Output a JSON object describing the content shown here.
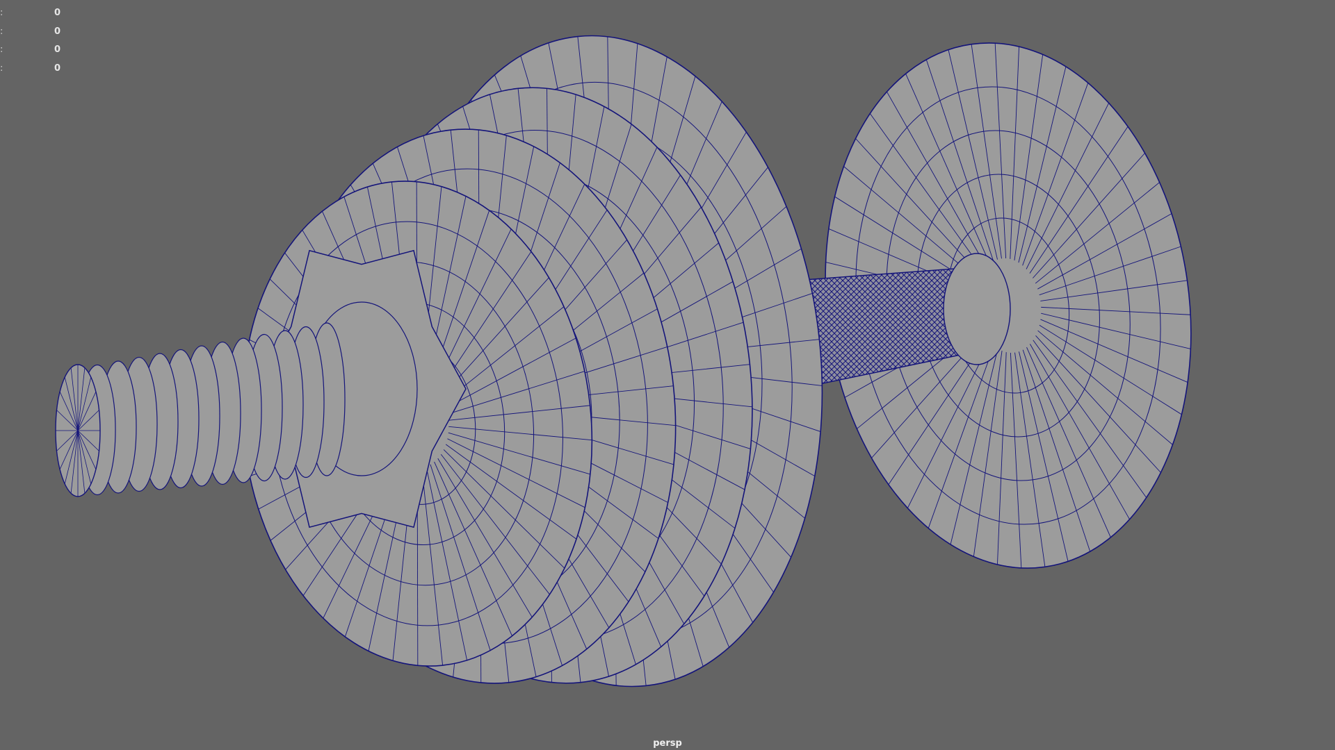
{
  "viewport": {
    "camera_name": "persp",
    "background_color": "#646464",
    "mesh_fill_color": "#9c9c9c",
    "wireframe_color": "#14147a"
  },
  "hud": {
    "rows": [
      {
        "value": "0"
      },
      {
        "value": "0"
      },
      {
        "value": "0"
      },
      {
        "value": "0"
      }
    ]
  },
  "scene": {
    "object": "dumbbell-mesh",
    "parts": [
      "threaded-bar-end",
      "spin-lock-collar",
      "weight-plate",
      "weight-plate",
      "weight-plate",
      "handle-grip",
      "far-weight-plate"
    ]
  }
}
